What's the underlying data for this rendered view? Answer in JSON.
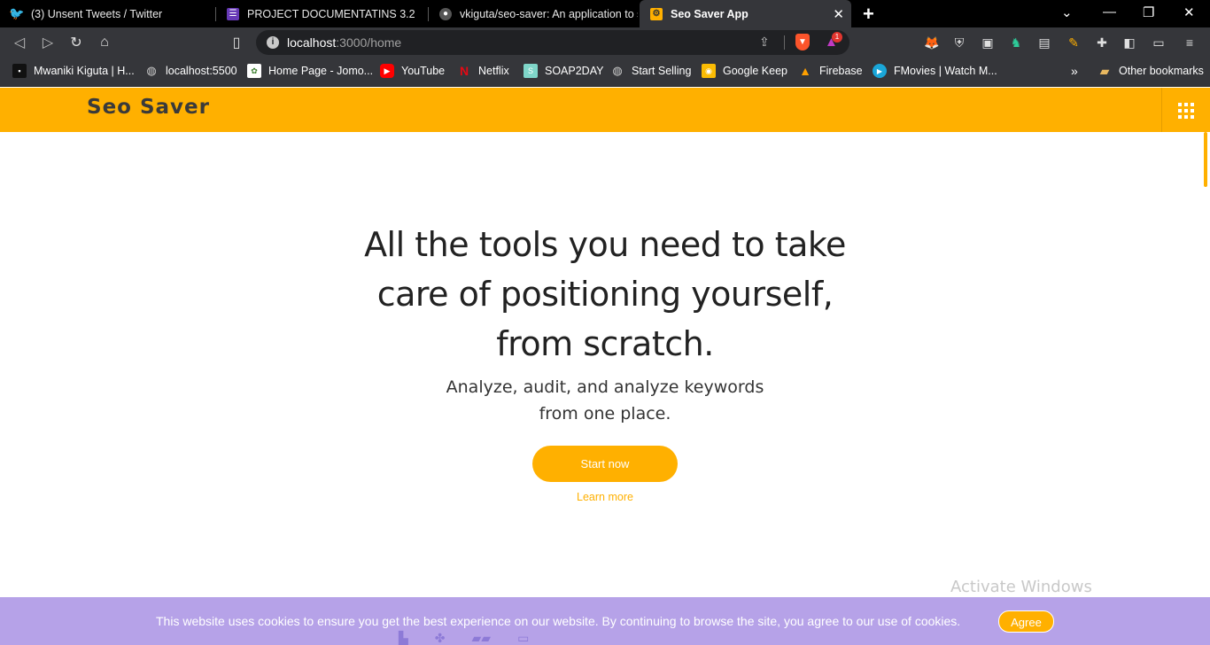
{
  "browser": {
    "tabs": [
      {
        "title": "(3) Unsent Tweets / Twitter",
        "icon": "twitter-icon",
        "color": "#1d9bf0",
        "active": false
      },
      {
        "title": "PROJECT DOCUMENTATINS 3.2",
        "icon": "document-icon",
        "color": "#673ab7",
        "active": false
      },
      {
        "title": "vkiguta/seo-saver: An application to st",
        "icon": "github-icon",
        "color": "#333333",
        "active": false
      },
      {
        "title": "Seo Saver App",
        "icon": "app-icon",
        "color": "#ffb000",
        "active": true
      }
    ],
    "url_host": "localhost",
    "url_path": ":3000/home",
    "rewards_badge": "1",
    "bookmarks": [
      {
        "label": "Mwaniki Kiguta | H...",
        "icon": "site-icon"
      },
      {
        "label": "localhost:5500",
        "icon": "globe-icon"
      },
      {
        "label": "Home Page - Jomo...",
        "icon": "crest-icon"
      },
      {
        "label": "YouTube",
        "icon": "youtube-icon"
      },
      {
        "label": "Netflix",
        "icon": "netflix-icon"
      },
      {
        "label": "SOAP2DAY",
        "icon": "soap2day-icon"
      },
      {
        "label": "Start Selling",
        "icon": "globe-icon"
      },
      {
        "label": "Google Keep",
        "icon": "keep-icon"
      },
      {
        "label": "Firebase",
        "icon": "firebase-icon"
      },
      {
        "label": "FMovies | Watch M...",
        "icon": "play-icon"
      }
    ],
    "overflow": "»",
    "other_bookmarks": "Other bookmarks"
  },
  "site": {
    "logo": "Seo Saver",
    "accent": "#ffb000",
    "hero_title": "All the tools you need to take care of positioning yourself, from scratch.",
    "hero_subtitle": "Analyze, audit, and analyze keywords from one place.",
    "cta": "Start now",
    "learn_more": "Learn more"
  },
  "cookie": {
    "message": "This website uses cookies to ensure you get the best experience on our website. By continuing to browse the site, you agree to our use of cookies.",
    "agree": "Agree"
  },
  "watermark": "Activate Windows"
}
